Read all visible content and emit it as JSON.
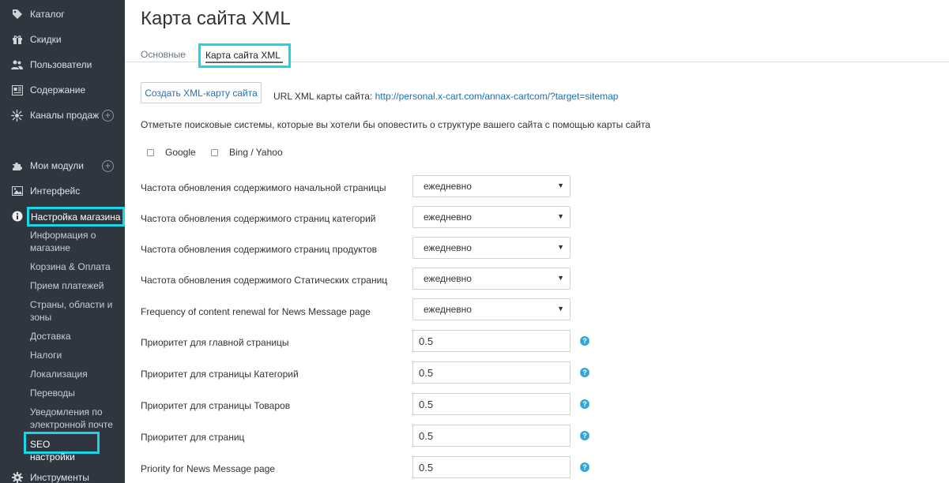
{
  "sidebar": {
    "items": [
      {
        "label": "Каталог",
        "icon": "tag-icon"
      },
      {
        "label": "Скидки",
        "icon": "gift-icon"
      },
      {
        "label": "Пользователи",
        "icon": "users-icon"
      },
      {
        "label": "Содержание",
        "icon": "content-icon"
      },
      {
        "label": "Каналы продаж",
        "icon": "sales-channels-icon"
      },
      {
        "label": "Мои модули",
        "icon": "puzzle-icon"
      },
      {
        "label": "Интерфейс",
        "icon": "image-icon"
      },
      {
        "label": "Настройка магазина",
        "icon": "info-icon"
      },
      {
        "label": "Инструменты",
        "icon": "gear-icon"
      }
    ],
    "store_settings_sub": [
      "Информация о магазине",
      "Корзина & Оплата",
      "Прием платежей",
      "Страны, области и зоны",
      "Доставка",
      "Налоги",
      "Локализация",
      "Переводы",
      "Уведомления по электронной почте",
      "SEO настройки"
    ]
  },
  "page": {
    "title": "Карта сайта XML",
    "tabs": [
      {
        "label": "Основные"
      },
      {
        "label": "Карта сайта XML"
      }
    ]
  },
  "sitemap": {
    "generate_button": "Создать XML-карту сайта",
    "url_label": "URL XML карты сайта:",
    "url": "http://personal.x-cart.com/annax-cartcom/?target=sitemap",
    "notify_text": "Отметьте поисковые системы, которые вы хотели бы оповестить о структуре вашего сайта с помощью карты сайта",
    "engines": [
      "Google",
      "Bing / Yahoo"
    ]
  },
  "settings": {
    "frequencies": [
      {
        "label": "Частота обновления содержимого начальной страницы",
        "value": "ежедневно"
      },
      {
        "label": "Частота обновления содержимого страниц категорий",
        "value": "ежедневно"
      },
      {
        "label": "Частота обновления содержимого страниц продуктов",
        "value": "ежедневно"
      },
      {
        "label": "Частота обновления содержимого Статических страниц",
        "value": "ежедневно"
      },
      {
        "label": "Frequency of content renewal for News Message page",
        "value": "ежедневно"
      }
    ],
    "priorities": [
      {
        "label": "Приоритет для главной страницы",
        "value": "0.5"
      },
      {
        "label": "Приоритет для страницы Категорий",
        "value": "0.5"
      },
      {
        "label": "Приоритет для страницы Товаров",
        "value": "0.5"
      },
      {
        "label": "Приоритет для страниц",
        "value": "0.5"
      },
      {
        "label": "Priority for News Message page",
        "value": "0.5"
      }
    ]
  },
  "colors": {
    "sidebar_bg": "#2f3640",
    "highlight": "#19d6e6",
    "link": "#1a6fb3",
    "help_icon": "#39a6d8"
  }
}
